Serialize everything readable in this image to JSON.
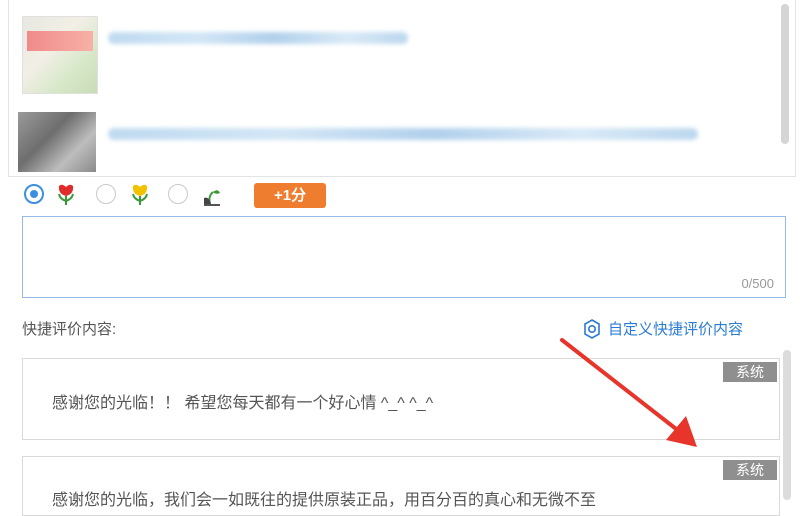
{
  "rating": {
    "options": [
      {
        "icon": "red-flower-icon",
        "selected": true
      },
      {
        "icon": "yellow-flower-icon",
        "selected": false
      },
      {
        "icon": "wilted-plant-icon",
        "selected": false
      }
    ],
    "bonus_label": "+1分"
  },
  "comment": {
    "value": "",
    "char_count": "0/500"
  },
  "quick_reviews": {
    "title": "快捷评价内容:",
    "custom_link": "自定义快捷评价内容",
    "items": [
      {
        "text": "感谢您的光临！！ 希望您每天都有一个好心情 ^_^ ^_^",
        "tag": "系统"
      },
      {
        "text": "感谢您的光临，我们会一如既往的提供原装正品，用百分百的真心和无微不至",
        "tag": "系统"
      }
    ]
  },
  "colors": {
    "accent": "#3d8fe0",
    "bonus": "#ee7d2f",
    "link": "#2a7bd5",
    "tag": "#8f8f8f",
    "arrow": "#e8352b"
  }
}
